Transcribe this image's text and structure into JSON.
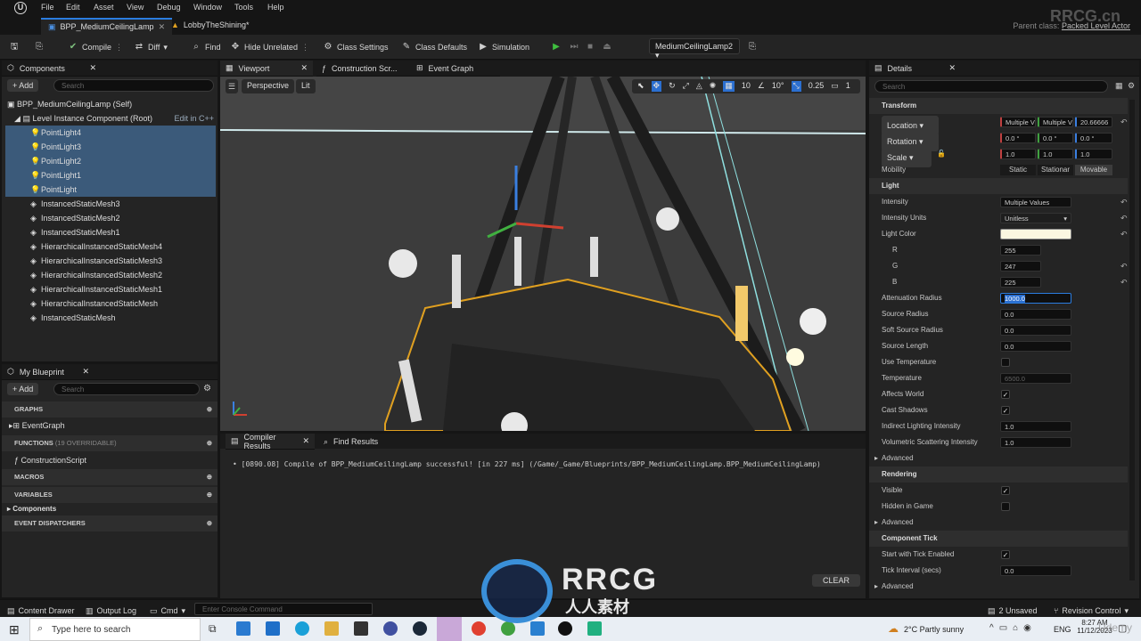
{
  "menubar": {
    "items": [
      "File",
      "Edit",
      "Asset",
      "View",
      "Debug",
      "Window",
      "Tools",
      "Help"
    ]
  },
  "doc_tabs": [
    {
      "label": "BPP_MediumCeilingLamp"
    },
    {
      "label": "LobbyTheShining*"
    }
  ],
  "parent_class": {
    "prefix": "Parent class:",
    "value": "Packed Level Actor"
  },
  "toolbar": {
    "compile": "Compile",
    "diff": "Diff",
    "find": "Find",
    "hide_unrelated": "Hide Unrelated",
    "class_settings": "Class Settings",
    "class_defaults": "Class Defaults",
    "simulation": "Simulation",
    "debug_object": "MediumCeilingLamp2"
  },
  "components_panel": {
    "tab": "Components",
    "add": "+ Add",
    "search_placeholder": "Search",
    "self": "BPP_MediumCeilingLamp (Self)",
    "root": "Level Instance Component (Root)",
    "edit_cpp": "Edit in C++",
    "items": [
      "PointLight4",
      "PointLight3",
      "PointLight2",
      "PointLight1",
      "PointLight",
      "InstancedStaticMesh3",
      "InstancedStaticMesh2",
      "InstancedStaticMesh1",
      "HierarchicalInstancedStaticMesh4",
      "HierarchicalInstancedStaticMesh3",
      "HierarchicalInstancedStaticMesh2",
      "HierarchicalInstancedStaticMesh1",
      "HierarchicalInstancedStaticMesh",
      "InstancedStaticMesh"
    ]
  },
  "my_blueprint": {
    "tab": "My Blueprint",
    "add": "+ Add",
    "search_placeholder": "Search",
    "graphs": "GRAPHS",
    "event_graph": "EventGraph",
    "functions": "FUNCTIONS",
    "functions_count": "(19 OVERRIDABLE)",
    "construction_script": "ConstructionScript",
    "macros": "MACROS",
    "variables": "VARIABLES",
    "components": "Components",
    "event_dispatchers": "EVENT DISPATCHERS"
  },
  "editor_tabs": {
    "viewport": "Viewport",
    "construction": "Construction Scr...",
    "event_graph": "Event Graph"
  },
  "viewport": {
    "perspective": "Perspective",
    "lit": "Lit",
    "grid": "10",
    "angle": "10°",
    "scale": "0.25",
    "camera": "1"
  },
  "bottom": {
    "compiler_tab": "Compiler Results",
    "find_tab": "Find Results",
    "message": "[0890.08] Compile of BPP_MediumCeilingLamp successful! [in 227 ms] (/Game/_Game/Blueprints/BPP_MediumCeilingLamp.BPP_MediumCeilingLamp)",
    "clear": "CLEAR"
  },
  "details": {
    "tab": "Details",
    "search_placeholder": "Search",
    "transform": "Transform",
    "location": "Location",
    "location_vals": [
      "Multiple V",
      "Multiple V",
      "20.66666"
    ],
    "rotation": "Rotation",
    "rotation_vals": [
      "0.0 °",
      "0.0 °",
      "0.0 °"
    ],
    "scale": "Scale",
    "scale_vals": [
      "1.0",
      "1.0",
      "1.0"
    ],
    "mobility": "Mobility",
    "mobility_opts": [
      "Static",
      "Stationar",
      "Movable"
    ],
    "light": "Light",
    "intensity": "Intensity",
    "intensity_val": "Multiple Values",
    "intensity_units": "Intensity Units",
    "intensity_units_val": "Unitless",
    "light_color": "Light Color",
    "r": "R",
    "r_val": "255",
    "g": "G",
    "g_val": "247",
    "b": "B",
    "b_val": "225",
    "attenuation": "Attenuation Radius",
    "attenuation_val": "1000.0",
    "source_radius": "Source Radius",
    "source_radius_val": "0.0",
    "soft_source": "Soft Source Radius",
    "soft_source_val": "0.0",
    "source_length": "Source Length",
    "source_length_val": "0.0",
    "use_temp": "Use Temperature",
    "temperature": "Temperature",
    "temperature_val": "6500.0",
    "affects_world": "Affects World",
    "cast_shadows": "Cast Shadows",
    "indirect": "Indirect Lighting Intensity",
    "indirect_val": "1.0",
    "volumetric": "Volumetric Scattering Intensity",
    "volumetric_val": "1.0",
    "advanced": "Advanced",
    "rendering": "Rendering",
    "visible": "Visible",
    "hidden_in_game": "Hidden in Game",
    "component_tick": "Component Tick",
    "start_tick": "Start with Tick Enabled",
    "tick_interval": "Tick Interval (secs)",
    "tick_interval_val": "0.0",
    "light_color_hex": "#fbf7e1"
  },
  "statusbar": {
    "content_drawer": "Content Drawer",
    "output_log": "Output Log",
    "cmd": "Cmd",
    "console_placeholder": "Enter Console Command",
    "unsaved": "2 Unsaved",
    "revision": "Revision Control"
  },
  "taskbar": {
    "search": "Type here to search",
    "weather": "2°C  Partly sunny",
    "lang": "ENG",
    "time": "8:27 AM",
    "date": "11/12/2023"
  },
  "watermark": {
    "top": "RRCG.cn",
    "logo_en": "RRCG",
    "logo_cn": "人人素材",
    "corner": "Udemy"
  }
}
